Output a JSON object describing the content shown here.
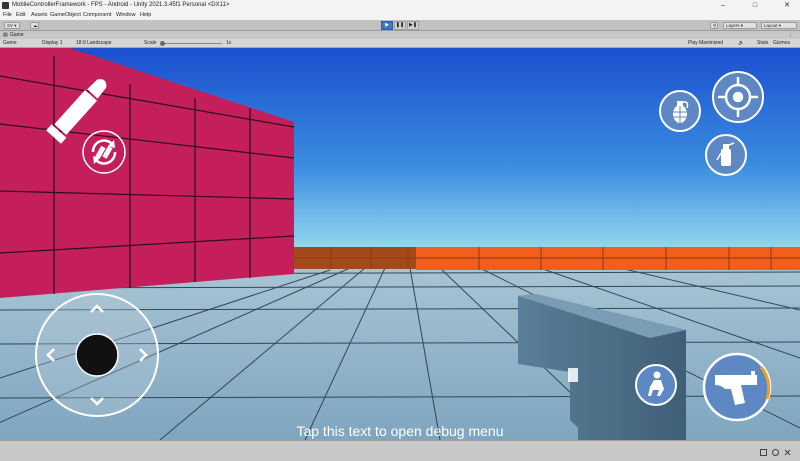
{
  "window": {
    "title": "MobileControllerFramework - FPS - Android - Unity 2021.3.45f1 Personal <DX11>",
    "minimize_glyph": "–",
    "maximize_glyph": "□",
    "close_glyph": "✕"
  },
  "menu": {
    "items": [
      "File",
      "Edit",
      "Assets",
      "GameObject",
      "Component",
      "Window",
      "Help"
    ]
  },
  "toolbar": {
    "account_label": "SV",
    "layers_label": "Layers",
    "layout_label": "Layout",
    "play_glyph": "▶",
    "pause_glyph": "❚❚",
    "step_glyph": "▶❚"
  },
  "panel": {
    "tab_label": "Game",
    "view_mode": "Game",
    "display": "Display 1",
    "aspect": "18:9 Landscape",
    "scale_label": "Scale",
    "scale_value": "1x",
    "play_mode": "Play Maximized",
    "stats_label": "Stats",
    "gizmos_label": "Gizmos"
  },
  "game": {
    "debug_text": "Tap this text to open debug menu",
    "icons": [
      "ammo-bullet-icon",
      "reload-icon",
      "grenade-icon",
      "crosshair-icon",
      "extinguisher-icon",
      "crouch-icon",
      "pistol-fire-icon",
      "joystick-icon"
    ],
    "colors": {
      "sky_top": "#1b4fcf",
      "sky_bottom": "#9fe0f2",
      "wall_pink": "#c41f5a",
      "wall_orange": "#f0601c",
      "floor": "#8fb2c8",
      "gun": "#4a6880"
    }
  }
}
